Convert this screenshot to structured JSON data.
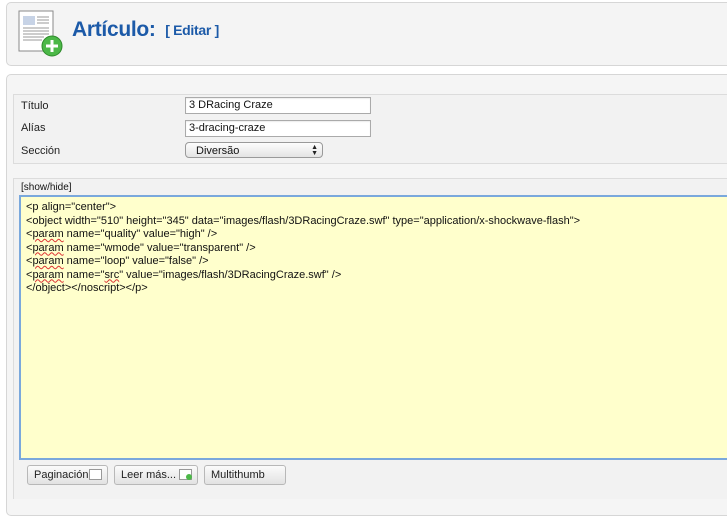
{
  "header": {
    "title": "Artículo:",
    "action": "[ Editar ]"
  },
  "fields": {
    "titulo": {
      "label": "Título",
      "value": "3 DRacing Craze"
    },
    "alias": {
      "label": "Alías",
      "value": "3-dracing-craze"
    },
    "seccion": {
      "label": "Sección",
      "selected": "Diversão"
    }
  },
  "editor": {
    "toggle_label": "[show/hide]",
    "lines": [
      "<p align=\"center\">",
      "<object width=\"510\" height=\"345\" data=\"images/flash/3DRacingCraze.swf\" type=\"application/x-shockwave-flash\">",
      "<param name=\"quality\" value=\"high\" />",
      "<param name=\"wmode\" value=\"transparent\" />",
      "<param name=\"loop\" value=\"false\" />",
      "<param name=\"src\" value=\"images/flash/3DRacingCraze.swf\" />",
      "</object></noscript></p>"
    ]
  },
  "buttons": {
    "paginacion": "Paginación",
    "leer_mas": "Leer más...",
    "multithumb": "Multithumb"
  }
}
